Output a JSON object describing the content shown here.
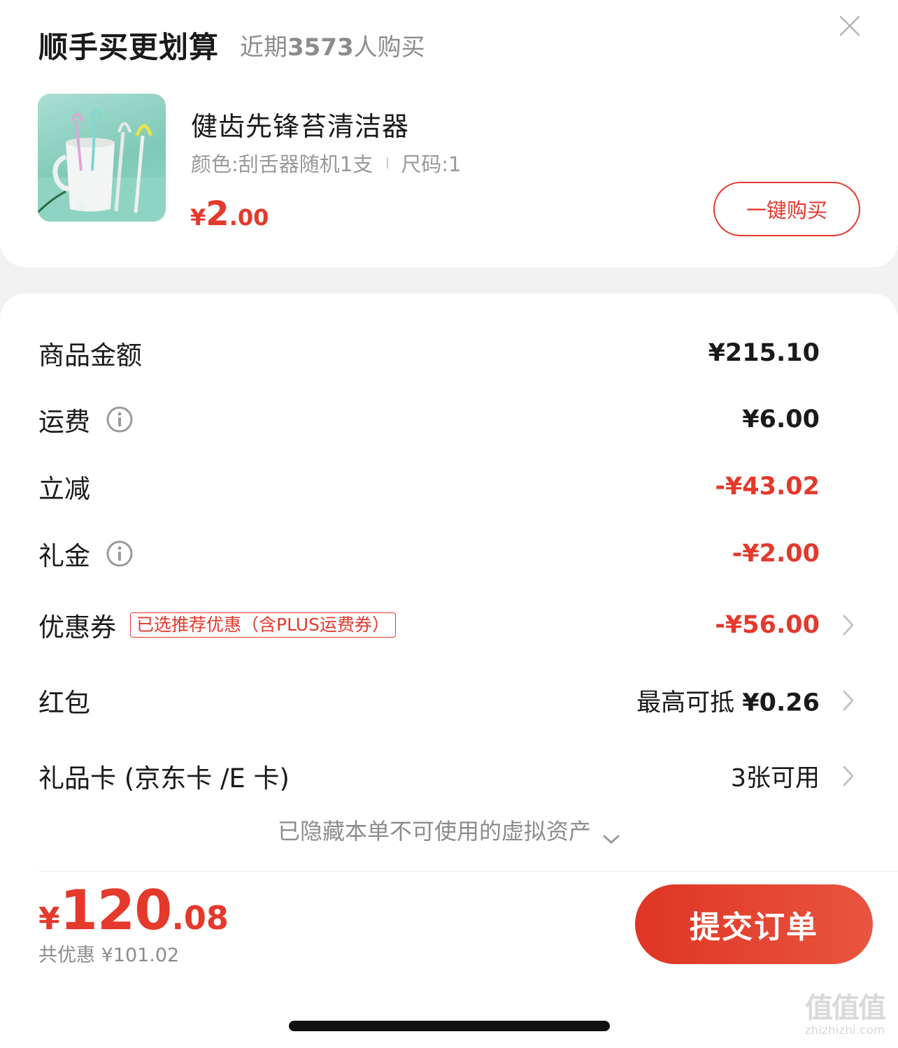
{
  "upsell": {
    "title": "顺手买更划算",
    "subtitle_prefix": "近期",
    "subtitle_count": "3573",
    "subtitle_suffix": "人购买",
    "product": {
      "name": "健齿先锋苔清洁器",
      "spec_color": "颜色:刮舌器随机1支",
      "spec_size": "尺码:1",
      "price_currency": "¥",
      "price_int": "2",
      "price_dec": ".00"
    },
    "buy_button": "一键购买"
  },
  "summary": {
    "goods_amount": {
      "label": "商品金额",
      "value": "¥215.10"
    },
    "shipping": {
      "label": "运费",
      "value": "¥6.00"
    },
    "instant_discount": {
      "label": "立减",
      "value": "-¥43.02"
    },
    "gift_money": {
      "label": "礼金",
      "value": "-¥2.00"
    },
    "coupon": {
      "label": "优惠券",
      "tag": "已选推荐优惠（含PLUS运费券）",
      "value": "-¥56.00"
    },
    "red_packet": {
      "label": "红包",
      "value_prefix": "最高可抵 ",
      "value": "¥0.26"
    },
    "gift_card": {
      "label": "礼品卡 (京东卡 /E 卡)",
      "value": "3张可用"
    },
    "hidden_assets": "已隐藏本单不可使用的虚拟资产"
  },
  "footer": {
    "total_currency": "¥",
    "total_int": "120",
    "total_dec": ".08",
    "saved": "共优惠 ¥101.02",
    "submit_button": "提交订单"
  },
  "watermark": {
    "logo": "值值值",
    "url": "zhizhizhi.com"
  },
  "colors": {
    "accent": "#e4392b",
    "text": "#1a1a1a",
    "muted": "#8c8c8c",
    "background": "#f2f2f2",
    "card": "#ffffff"
  },
  "icons": [
    "close-icon",
    "info-icon",
    "chevron-right-icon",
    "chevron-down-icon"
  ]
}
